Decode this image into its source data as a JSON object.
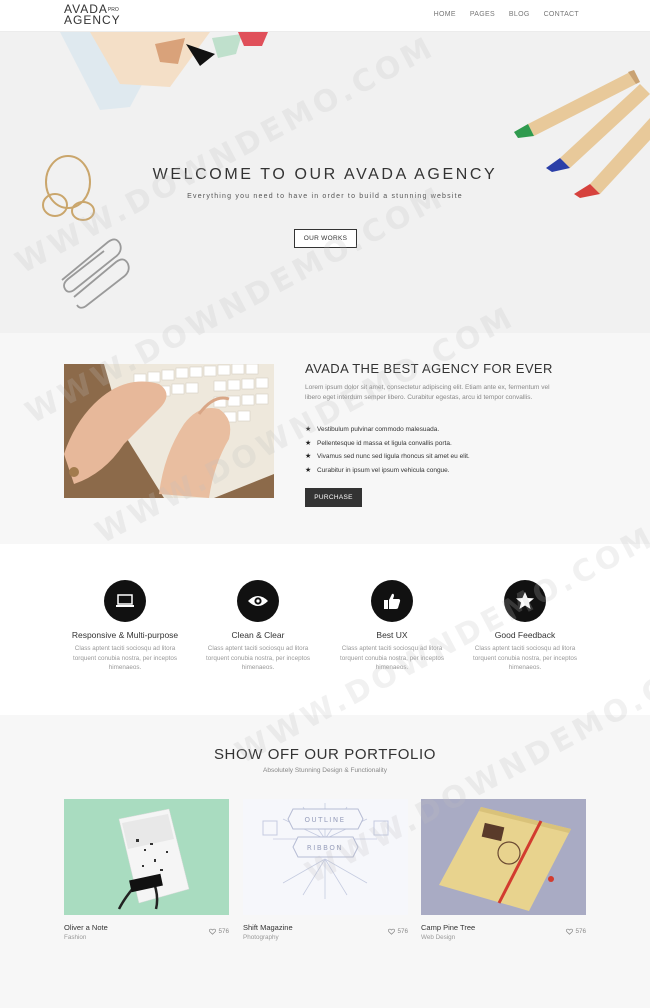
{
  "header": {
    "logo_line1": "AVADA",
    "logo_badge": "PRO",
    "logo_line2": "AGENCY",
    "nav": [
      "HOME",
      "PAGES",
      "BLOG",
      "CONTACT"
    ]
  },
  "hero": {
    "title": "WELCOME TO OUR AVADA AGENCY",
    "subtitle": "Everything you need to have in order to build a stunning website",
    "button": "OUR WORKS"
  },
  "about": {
    "title": "AVADA THE BEST AGENCY FOR EVER",
    "text": "Lorem ipsum dolor sit amet, consectetur adipiscing elit. Etiam ante ex, fermentum vel libero eget interdum semper libero. Curabitur egestas, arcu id tempor convallis.",
    "list": [
      "Vestibulum pulvinar commodo malesuada.",
      "Pellentesque id massa et ligula convallis porta.",
      "Vivamus sed nunc sed ligula rhoncus sit amet eu elit.",
      "Curabitur in ipsum vel ipsum vehicula congue."
    ],
    "button": "PURCHASE"
  },
  "features": [
    {
      "title": "Responsive & Multi-purpose",
      "desc": "Class aptent taciti sociosqu ad litora torquent conubia nostra, per inceptos himenaeos.",
      "icon": "laptop-icon"
    },
    {
      "title": "Clean & Clear",
      "desc": "Class aptent taciti sociosqu ad litora torquent conubia nostra, per inceptos himenaeos.",
      "icon": "eye-icon"
    },
    {
      "title": "Best UX",
      "desc": "Class aptent taciti sociosqu ad litora torquent conubia nostra, per inceptos himenaeos.",
      "icon": "thumbs-up-icon"
    },
    {
      "title": "Good Feedback",
      "desc": "Class aptent taciti sociosqu ad litora torquent conubia nostra, per inceptos himenaeos.",
      "icon": "star-icon"
    }
  ],
  "portfolio": {
    "title": "SHOW OFF OUR PORTFOLIO",
    "subtitle": "Absolutely Stunning Design & Functionality",
    "items": [
      {
        "name": "Oliver a Note",
        "category": "Fashion",
        "likes": "576"
      },
      {
        "name": "Shift Magazine",
        "category": "Photography",
        "likes": "576"
      },
      {
        "name": "Camp Pine Tree",
        "category": "Web Design",
        "likes": "576"
      }
    ],
    "ribbon_top": "OUTLINE",
    "ribbon_bottom": "RIBBON"
  },
  "watermark": "WWW.DOWNDEMO.COM",
  "colors": {
    "accent_dark": "#333333",
    "hero_bg": "#f1f1f1",
    "section_bg": "#f7f7f7"
  }
}
